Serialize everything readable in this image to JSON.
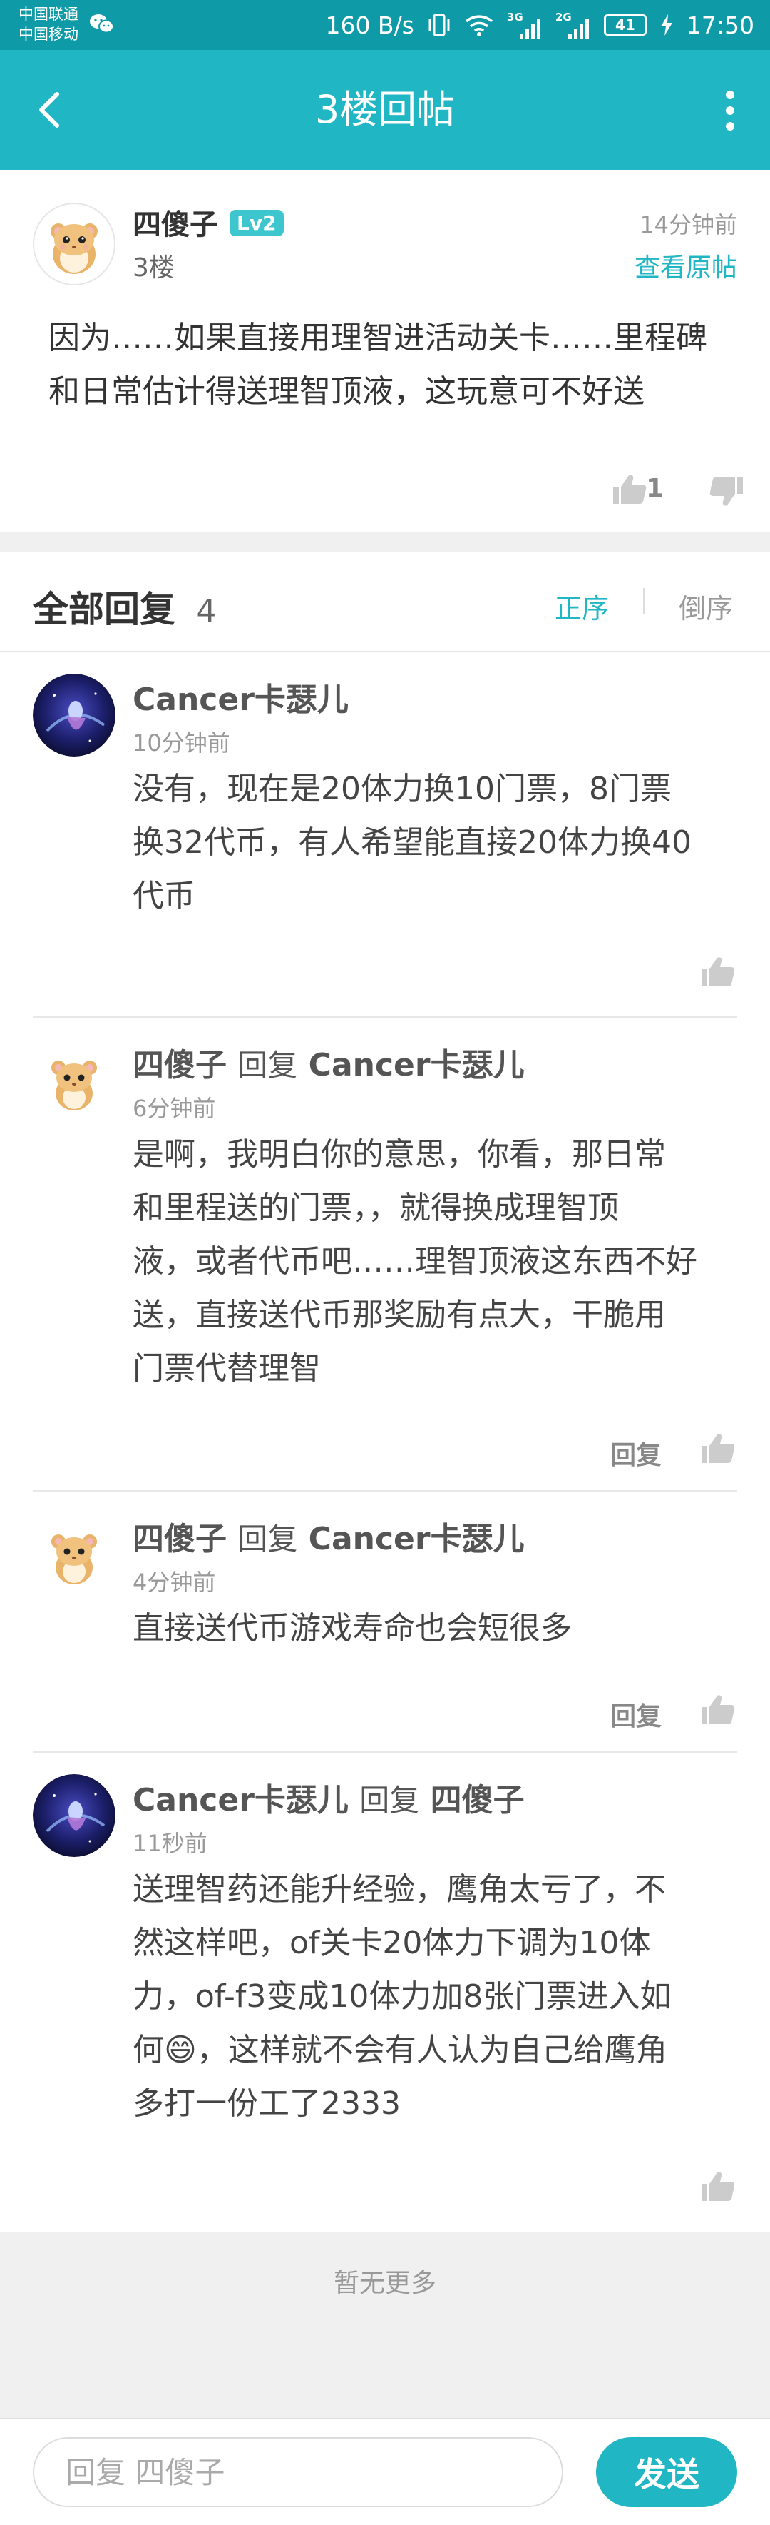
{
  "status_bar": {
    "carrier1": "中国联通",
    "carrier2": "中国移动",
    "speed": "160 B/s",
    "signal1_tag": "3G",
    "signal2_tag": "2G",
    "battery": "41",
    "time": "17:50"
  },
  "header": {
    "title": "3楼回帖"
  },
  "post": {
    "author": "四傻子",
    "level": "Lv2",
    "floor": "3楼",
    "time": "14分钟前",
    "view_original": "查看原帖",
    "content": [
      "因为……如果直接用理智进活动关卡……里程碑",
      "和日常估计得送理智顶液，这玩意可不好送"
    ],
    "like_count": "1"
  },
  "replies_header": {
    "title": "全部回复",
    "count": "4",
    "sort_asc": "正序",
    "sort_desc": "倒序"
  },
  "replies": [
    {
      "author": "Cancer卡瑟儿",
      "reply_word": "",
      "target": "",
      "time": "10分钟前",
      "lines": [
        "没有，现在是20体力换10门票，8门票",
        "换32代币，有人希望能直接20体力换40",
        "代币"
      ],
      "reply_label": ""
    },
    {
      "author": "四傻子",
      "reply_word": "回复",
      "target": "Cancer卡瑟儿",
      "time": "6分钟前",
      "lines": [
        "是啊，我明白你的意思，你看，那日常",
        "和里程送的门票，，就得换成理智顶",
        "液，或者代币吧……理智顶液这东西不好",
        "送，直接送代币那奖励有点大，干脆用",
        "门票代替理智"
      ],
      "reply_label": "回复"
    },
    {
      "author": "四傻子",
      "reply_word": "回复",
      "target": "Cancer卡瑟儿",
      "time": "4分钟前",
      "lines": [
        "直接送代币游戏寿命也会短很多"
      ],
      "reply_label": "回复"
    },
    {
      "author": "Cancer卡瑟儿",
      "reply_word": "回复",
      "target": "四傻子",
      "time": "11秒前",
      "lines": [
        "送理智药还能升经验，鹰角太亏了，不",
        "然这样吧，of关卡20体力下调为10体",
        "力，of-f3变成10体力加8张门票进入如",
        "何😄，这样就不会有人认为自己给鹰角",
        "多打一份工了2333"
      ],
      "reply_label": ""
    }
  ],
  "footer": {
    "no_more": "暂无更多"
  },
  "input_bar": {
    "placeholder": "回复 四傻子",
    "send_label": "发送"
  },
  "colors": {
    "status_bar": "#0e9aa6",
    "title_bar": "#21b6c4",
    "accent": "#21b6c4"
  }
}
